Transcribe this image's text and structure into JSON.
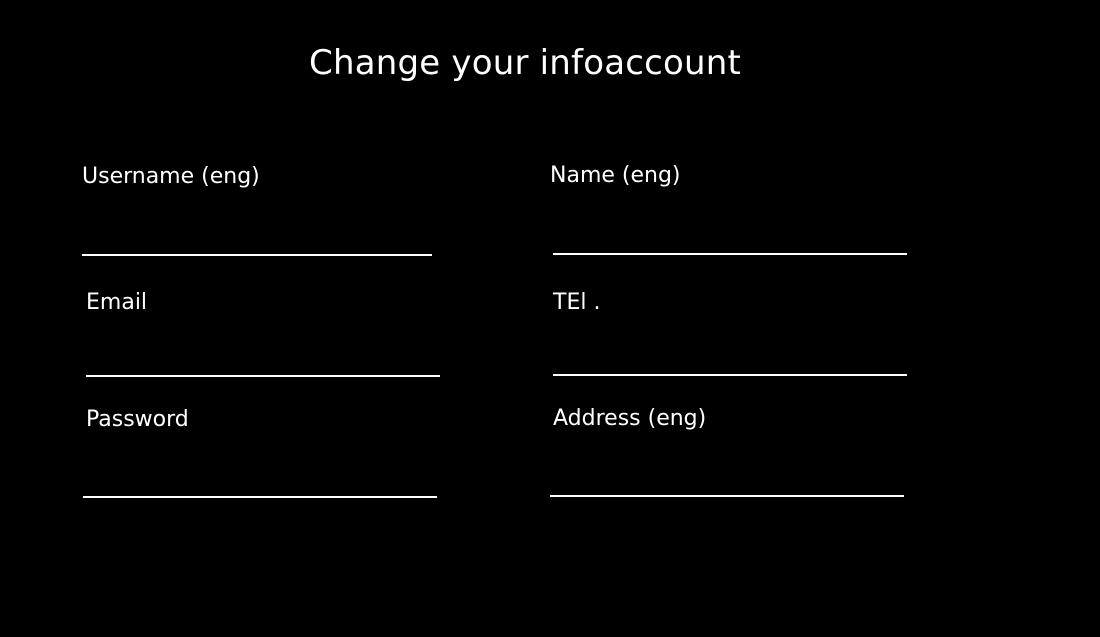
{
  "page": {
    "title": "Change your infoaccount"
  },
  "form": {
    "username": {
      "label": "Username  (eng)",
      "value": "",
      "placeholder": ""
    },
    "name": {
      "label": "Name  (eng)",
      "value": "",
      "placeholder": ""
    },
    "email": {
      "label": "Email",
      "value": "",
      "placeholder": ""
    },
    "tel": {
      "label": "TEl .",
      "value": "",
      "placeholder": ""
    },
    "password": {
      "label": "Password",
      "value": "",
      "placeholder": ""
    },
    "address": {
      "label": "Address  (eng)",
      "value": "",
      "placeholder": ""
    }
  },
  "colors": {
    "background": "#000000",
    "text": "#ffffff",
    "underline": "#ffffff"
  }
}
